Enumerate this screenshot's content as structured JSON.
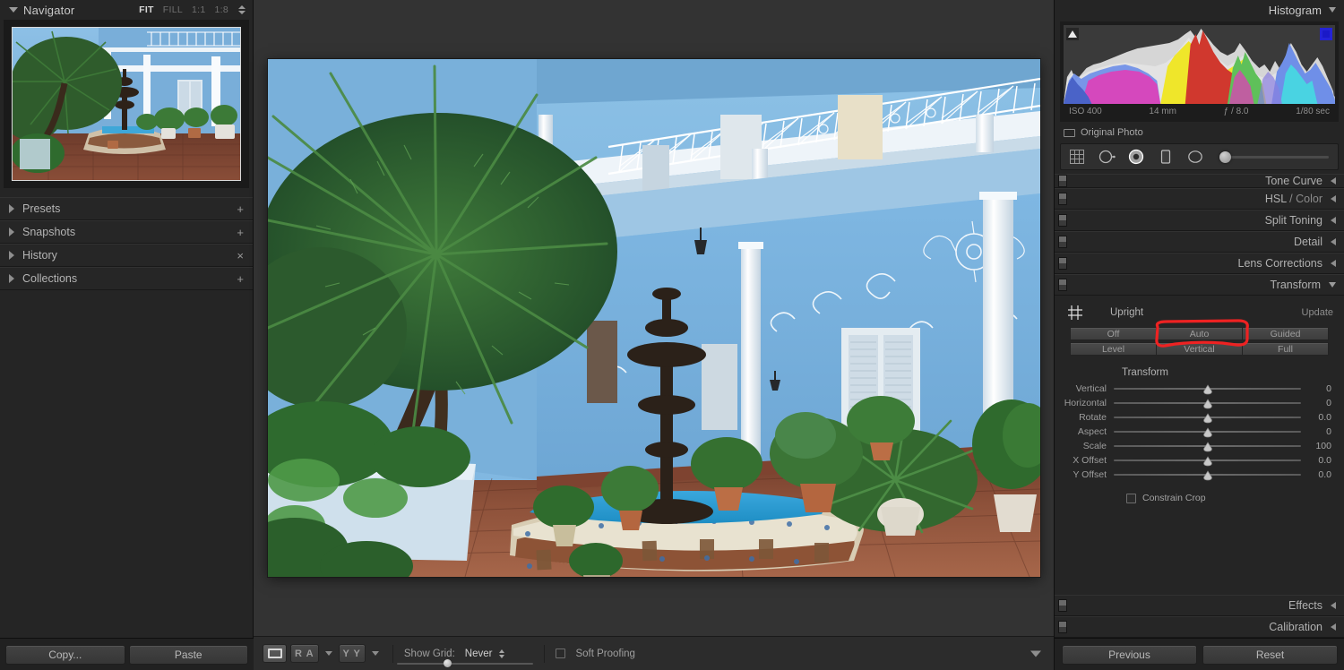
{
  "navigator": {
    "title": "Navigator",
    "zoom_levels": [
      {
        "label": "FIT",
        "active": true
      },
      {
        "label": "FILL",
        "active": false
      },
      {
        "label": "1:1",
        "active": false
      },
      {
        "label": "1:8",
        "active": false
      }
    ]
  },
  "left_panels": [
    {
      "label": "Presets",
      "action": "+"
    },
    {
      "label": "Snapshots",
      "action": "+"
    },
    {
      "label": "History",
      "action": "×"
    },
    {
      "label": "Collections",
      "action": "+"
    }
  ],
  "left_bottom": {
    "copy_label": "Copy...",
    "paste_label": "Paste"
  },
  "toolbar": {
    "loupe_icon": "loupe-view-icon",
    "before_after_label": "R A",
    "before_after_label2": "Y Y",
    "show_grid_label": "Show Grid:",
    "show_grid_value": "Never",
    "soft_proofing_label": "Soft Proofing",
    "soft_proofing_checked": false
  },
  "histogram": {
    "title": "Histogram",
    "iso": "ISO 400",
    "focal": "14 mm",
    "aperture": "ƒ / 8.0",
    "shutter": "1/80 sec",
    "original_photo_label": "Original Photo",
    "shadow_clip_on": true,
    "highlight_clip_on": true,
    "highlight_clip_color": "#2423d6"
  },
  "toolstrip": {
    "icons": [
      "crop-overlay-icon",
      "spot-removal-icon",
      "red-eye-correction-icon",
      "graduated-filter-icon",
      "radial-filter-icon"
    ],
    "brush_slider_value": 0
  },
  "sections": [
    {
      "label": "Tone Curve",
      "sub": "",
      "expanded": false
    },
    {
      "label": "HSL",
      "sub": " / Color",
      "expanded": false
    },
    {
      "label": "Split Toning",
      "sub": "",
      "expanded": false
    },
    {
      "label": "Detail",
      "sub": "",
      "expanded": false
    },
    {
      "label": "Lens Corrections",
      "sub": "",
      "expanded": false
    },
    {
      "label": "Transform",
      "sub": "",
      "expanded": true
    }
  ],
  "transform": {
    "upright_label": "Upright",
    "update_label": "Update",
    "upright_icon": "upright-grid-icon",
    "upright_buttons_row1": [
      "Off",
      "Auto",
      "Guided"
    ],
    "upright_buttons_row2": [
      "Level",
      "Vertical",
      "Full"
    ],
    "highlighted_button": "Auto",
    "annotation_color": "#ee2222",
    "transform_title": "Transform",
    "sliders": [
      {
        "label": "Vertical",
        "value": "0"
      },
      {
        "label": "Horizontal",
        "value": "0"
      },
      {
        "label": "Rotate",
        "value": "0.0"
      },
      {
        "label": "Aspect",
        "value": "0"
      },
      {
        "label": "Scale",
        "value": "100"
      },
      {
        "label": "X Offset",
        "value": "0.0"
      },
      {
        "label": "Y Offset",
        "value": "0.0"
      }
    ],
    "constrain_crop_label": "Constrain Crop",
    "constrain_crop_checked": false
  },
  "bottom_sections": [
    {
      "label": "Effects"
    },
    {
      "label": "Calibration"
    }
  ],
  "right_bottom": {
    "previous_label": "Previous",
    "reset_label": "Reset"
  },
  "photo": {
    "description": "Cuban colonial courtyard with light blue walls, white columns and wrought-iron balcony railings, tall palm trees, a dark stone fountain, tiled pool surround and terracotta floor tiles"
  }
}
